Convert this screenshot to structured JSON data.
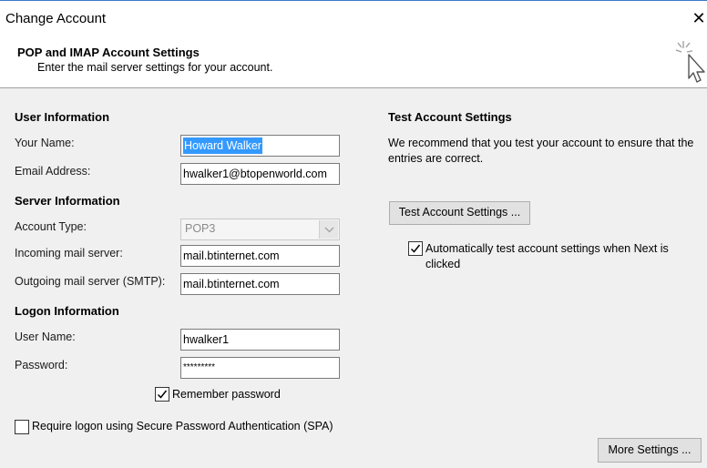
{
  "window": {
    "title": "Change Account"
  },
  "header": {
    "title": "POP and IMAP Account Settings",
    "subtitle": "Enter the mail server settings for your account."
  },
  "user_info": {
    "section": "User Information",
    "name_label": "Your Name:",
    "name_value": "Howard Walker",
    "email_label": "Email Address:",
    "email_value": "hwalker1@btopenworld.com"
  },
  "server_info": {
    "section": "Server Information",
    "account_type_label": "Account Type:",
    "account_type_value": "POP3",
    "incoming_label": "Incoming mail server:",
    "incoming_value": "mail.btinternet.com",
    "outgoing_label": "Outgoing mail server (SMTP):",
    "outgoing_value": "mail.btinternet.com"
  },
  "logon_info": {
    "section": "Logon Information",
    "username_label": "User Name:",
    "username_value": "hwalker1",
    "password_label": "Password:",
    "password_value": "*********",
    "remember_label": "Remember password",
    "spa_label": "Require logon using Secure Password Authentication (SPA)"
  },
  "test_settings": {
    "section": "Test Account Settings",
    "description": "We recommend that you test your account to ensure that the entries are correct.",
    "button_label": "Test Account Settings ...",
    "auto_test_label": "Automatically test account settings when Next is clicked"
  },
  "more_settings_label": "More Settings ..."
}
